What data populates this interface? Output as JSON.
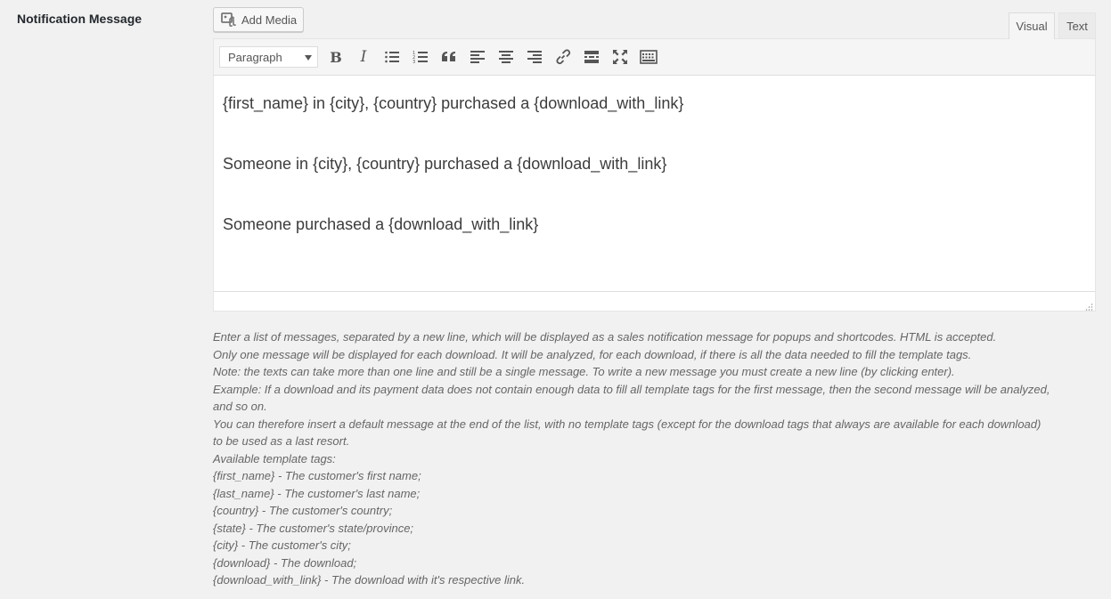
{
  "field": {
    "label": "Notification Message"
  },
  "media": {
    "add_label": "Add Media"
  },
  "tabs": {
    "visual": "Visual",
    "text": "Text"
  },
  "toolbar": {
    "format_value": "Paragraph",
    "bold": "B",
    "italic": "I"
  },
  "editor": {
    "lines": [
      "{first_name} in {city}, {country} purchased a {download_with_link}",
      "Someone in {city}, {country} purchased a {download_with_link}",
      "Someone purchased a {download_with_link}"
    ]
  },
  "help": {
    "lines": [
      "Enter a list of messages, separated by a new line, which will be displayed as a sales notification message for popups and shortcodes. HTML is accepted.",
      "Only one message will be displayed for each download. It will be analyzed, for each download, if there is all the data needed to fill the template tags.",
      "Note: the texts can take more than one line and still be a single message. To write a new message you must create a new line (by clicking enter).",
      "Example: If a download and its payment data does not contain enough data to fill all template tags for the first message, then the second message will be analyzed,",
      "and so on.",
      "You can therefore insert a default message at the end of the list, with no template tags (except for the download tags that always are available for each download)",
      "to be used as a last resort.",
      "Available template tags:",
      "{first_name} - The customer's first name;",
      "{last_name} - The customer's last name;",
      "{country} - The customer's country;",
      "{state} - The customer's state/province;",
      "{city} - The customer's city;",
      "{download} - The download;",
      "{download_with_link} - The download with it's respective link."
    ]
  },
  "icons": {
    "media": "add-media-icon",
    "bullet_list": "bullet-list-icon",
    "numbered_list": "numbered-list-icon",
    "blockquote": "blockquote-icon",
    "align_left": "align-left-icon",
    "align_center": "align-center-icon",
    "align_right": "align-right-icon",
    "link": "link-icon",
    "read_more": "read-more-icon",
    "fullscreen": "fullscreen-icon",
    "toolbar_toggle": "toolbar-toggle-icon"
  }
}
